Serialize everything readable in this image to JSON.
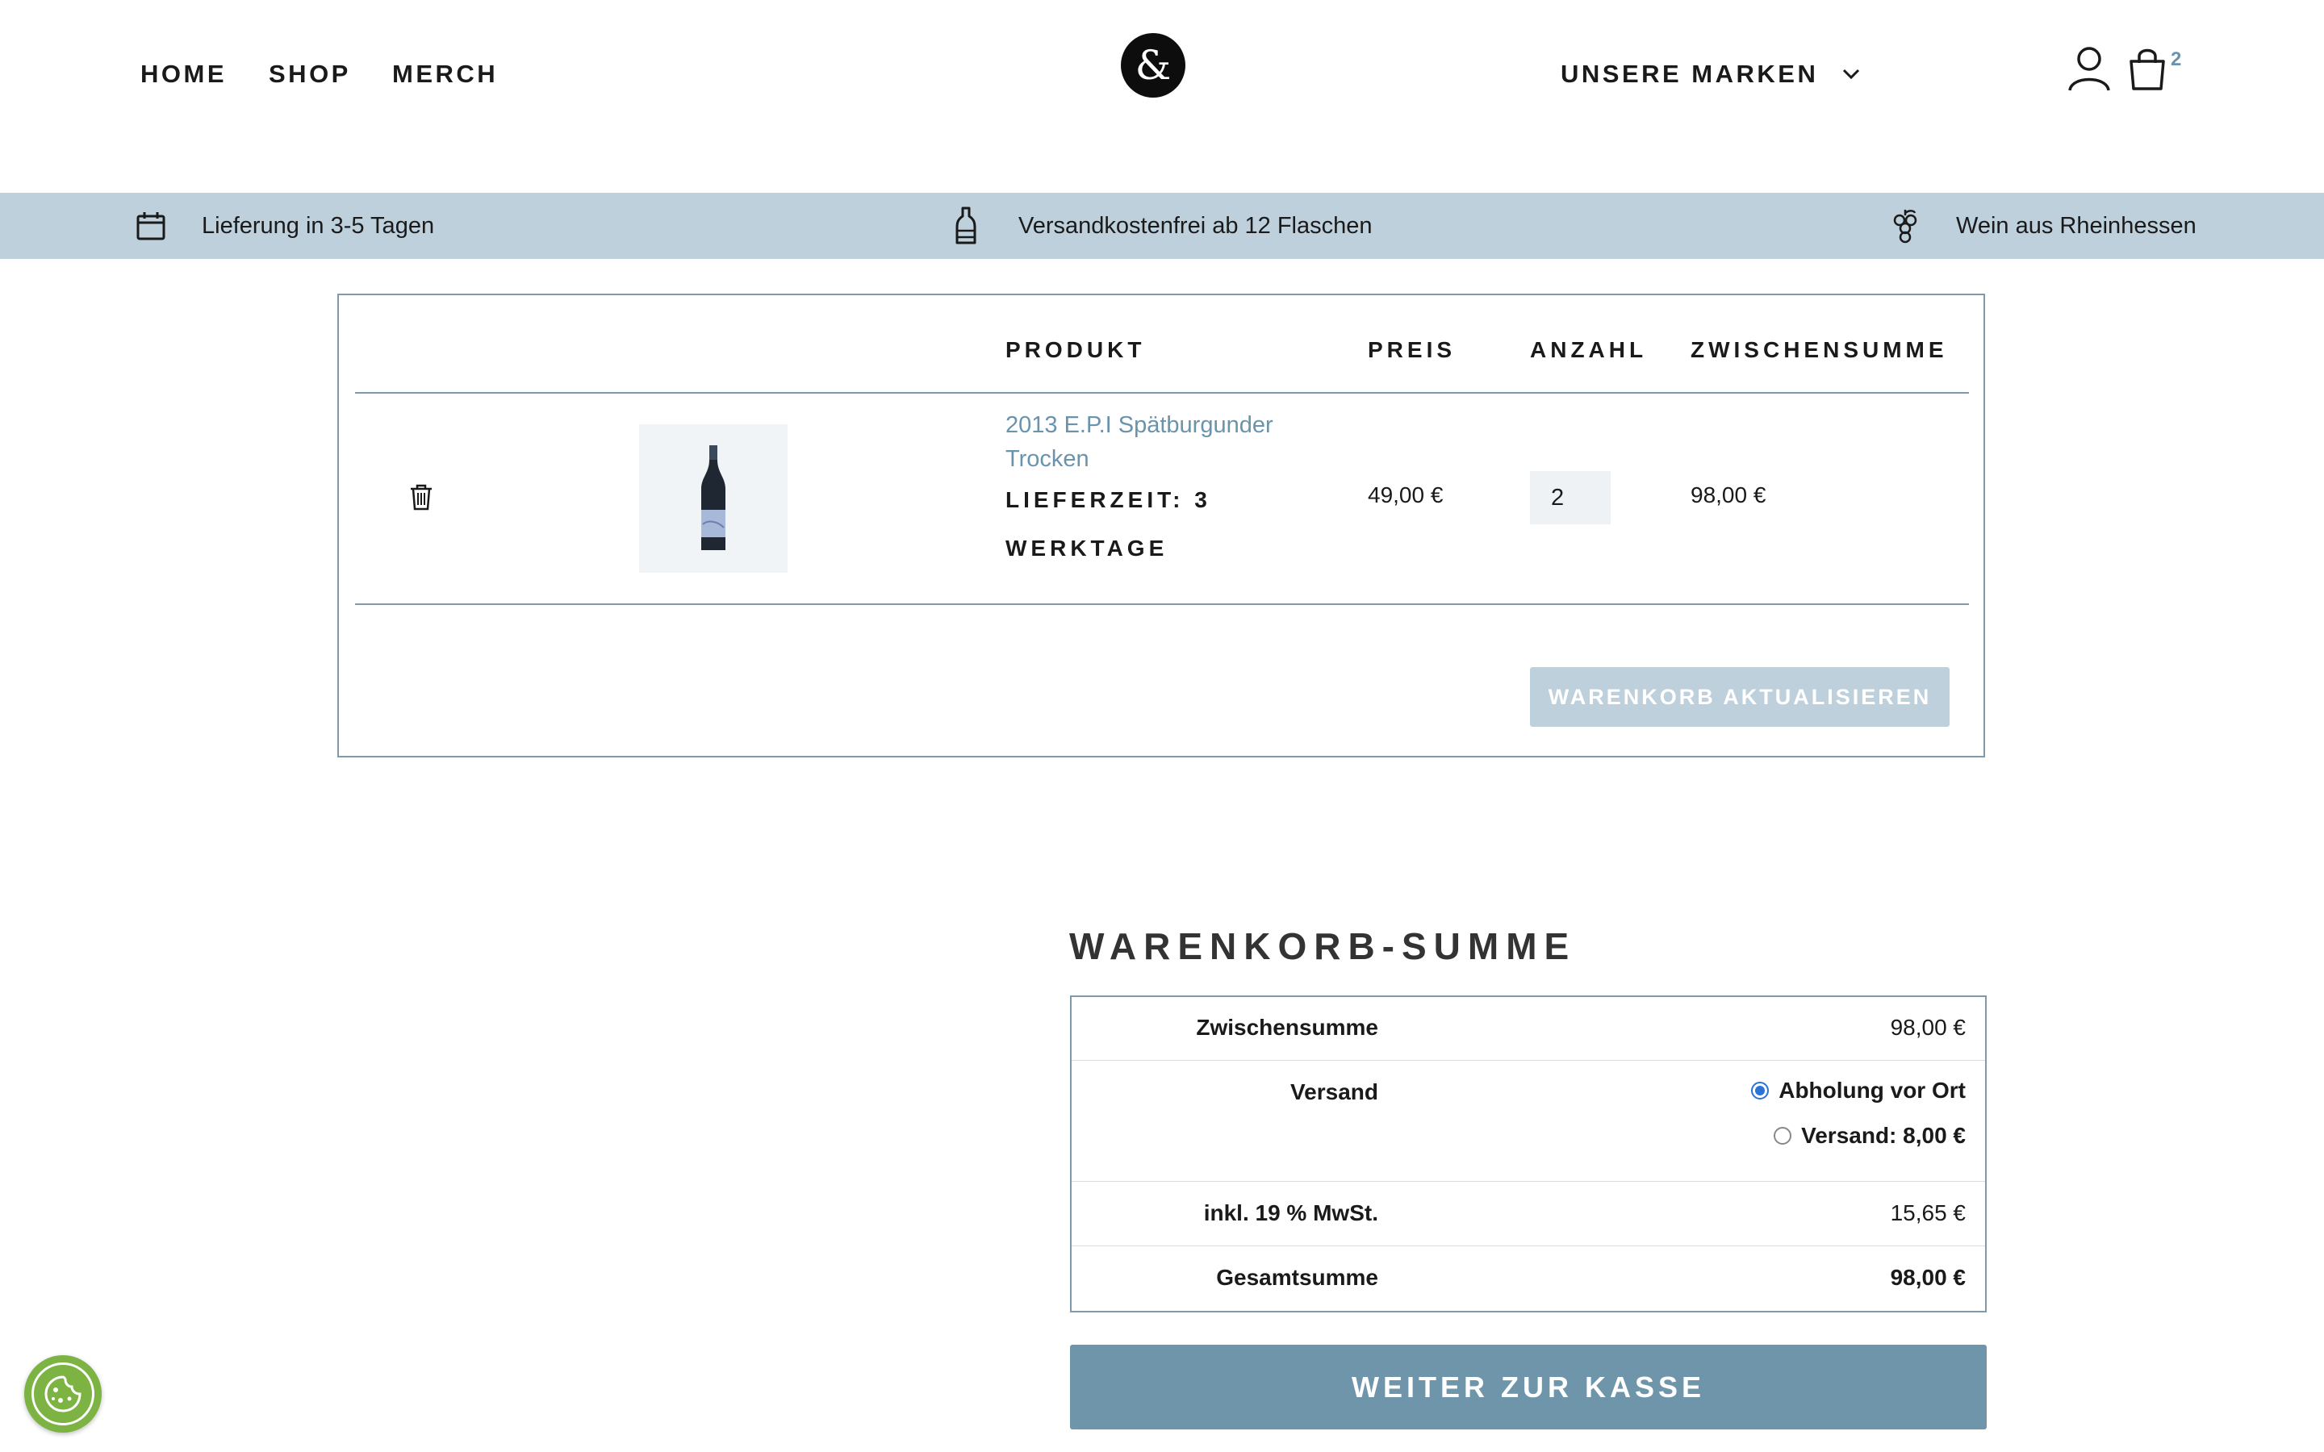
{
  "header": {
    "nav": [
      "HOME",
      "SHOP",
      "MERCH"
    ],
    "brands_dropdown": "UNSERE MARKEN",
    "cart_count": "2",
    "icons": {
      "logo": "ampersand-logo",
      "account": "user-icon",
      "cart": "shopping-bag-icon",
      "dropdown": "chevron-down-icon"
    }
  },
  "infobar": {
    "delivery": "Lieferung in 3-5 Tagen",
    "shipping": "Versandkostenfrei ab 12 Flaschen",
    "origin": "Wein aus Rheinhessen",
    "icons": [
      "calendar-icon",
      "bottle-icon",
      "grapes-icon"
    ]
  },
  "cart": {
    "headers": {
      "product": "PRODUKT",
      "price": "PREIS",
      "qty": "ANZAHL",
      "subtotal": "ZWISCHENSUMME"
    },
    "items": [
      {
        "name": "2013 E.P.I Spätburgunder Trocken",
        "name_line1": "2013 E.P.I Spätburgunder",
        "name_line2": "Trocken",
        "delivery_line1": "LIEFERZEIT: 3",
        "delivery_line2": "WERKTAGE",
        "price": "49,00 €",
        "quantity": "2",
        "subtotal": "98,00 €"
      }
    ],
    "update_button": "WARENKORB AKTUALISIEREN"
  },
  "totals": {
    "title": "WARENKORB-SUMME",
    "subtotal_label": "Zwischensumme",
    "subtotal_value": "98,00 €",
    "shipping_label": "Versand",
    "shipping_options": [
      {
        "label": "Abholung vor Ort",
        "selected": true
      },
      {
        "label": "Versand: 8,00 €",
        "selected": false
      }
    ],
    "tax_label": "inkl. 19 % MwSt.",
    "tax_value": "15,65 €",
    "total_label": "Gesamtsumme",
    "total_value": "98,00 €"
  },
  "checkout_button": "WEITER ZUR KASSE",
  "colors": {
    "accent": "#6f95aa",
    "infobar": "#bfd0dd",
    "link": "#6a93ad",
    "border": "#7e9aab",
    "cookie": "#7cb342"
  }
}
